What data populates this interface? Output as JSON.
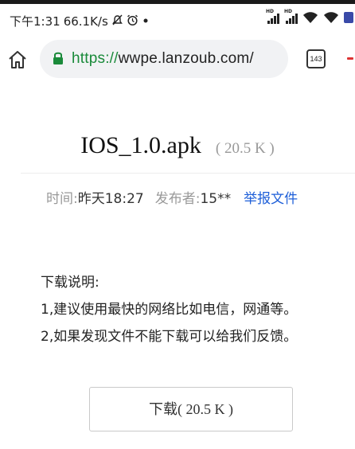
{
  "status_bar": {
    "time": "下午1:31",
    "net_speed": "66.1K/s",
    "icons": [
      "mute-icon",
      "alarm-icon",
      "dot-icon",
      "hd-signal-icon",
      "hd-signal-icon",
      "wifi-icon",
      "wifi-icon",
      "battery-icon"
    ],
    "hd_label": "HD",
    "battery_color": "#3a4aa8"
  },
  "browser": {
    "url_scheme": "https://",
    "url_host": "wwpe.lanzoub.com/",
    "tab_count": "143",
    "scheme_color": "#1a8a3a"
  },
  "file": {
    "name": "IOS_1.0.apk",
    "size": "( 20.5 K )"
  },
  "meta": {
    "time_label": "时间:",
    "time_value": "昨天18:27",
    "uploader_label": "发布者:",
    "uploader_value": "15**",
    "report_link": "举报文件",
    "link_color": "#1e5fd8"
  },
  "description": {
    "heading": "下载说明:",
    "lines": [
      "1,建议使用最快的网络比如电信，网通等。",
      "2,如果发现文件不能下载可以给我们反馈。"
    ]
  },
  "download": {
    "label": "下载( 20.5 K )"
  }
}
